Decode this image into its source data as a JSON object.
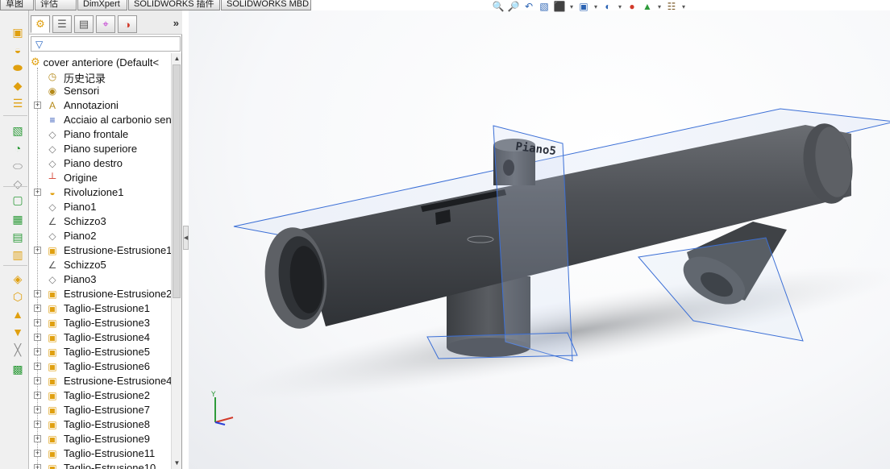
{
  "tabs": [
    "草图",
    "评估",
    "DimXpert",
    "SOLIDWORKS 插件",
    "SOLIDWORKS MBD"
  ],
  "hud_icons": [
    "zoom-to-fit-icon",
    "zoom-area-icon",
    "previous-view-icon",
    "section-view-icon",
    "view-orientation-icon",
    "display-style-icon",
    "hide-show-icon",
    "edit-appearance-icon",
    "apply-scene-icon",
    "view-settings-icon"
  ],
  "feature_manager": {
    "root": "cover anteriore  (Default<",
    "items": [
      {
        "label": "历史记录",
        "icon": "history-icon",
        "expand": false
      },
      {
        "label": "Sensori",
        "icon": "sensor-icon",
        "expand": false
      },
      {
        "label": "Annotazioni",
        "icon": "annotation-icon",
        "expand": true
      },
      {
        "label": "Acciaio al carbonio sen",
        "icon": "material-icon",
        "expand": false
      },
      {
        "label": "Piano frontale",
        "icon": "plane-icon",
        "expand": false
      },
      {
        "label": "Piano superiore",
        "icon": "plane-icon",
        "expand": false
      },
      {
        "label": "Piano destro",
        "icon": "plane-icon",
        "expand": false
      },
      {
        "label": "Origine",
        "icon": "origin-icon",
        "expand": false
      },
      {
        "label": "Rivoluzione1",
        "icon": "revolve-icon",
        "expand": true
      },
      {
        "label": "Piano1",
        "icon": "plane-icon",
        "expand": false
      },
      {
        "label": "Schizzo3",
        "icon": "sketch-icon",
        "expand": false
      },
      {
        "label": "Piano2",
        "icon": "plane-icon",
        "expand": false
      },
      {
        "label": "Estrusione-Estrusione1",
        "icon": "extrude-icon",
        "expand": true
      },
      {
        "label": "Schizzo5",
        "icon": "sketch-icon",
        "expand": false
      },
      {
        "label": "Piano3",
        "icon": "plane-icon",
        "expand": false
      },
      {
        "label": "Estrusione-Estrusione2",
        "icon": "extrude-icon",
        "expand": true
      },
      {
        "label": "Taglio-Estrusione1",
        "icon": "cut-extrude-icon",
        "expand": true
      },
      {
        "label": "Taglio-Estrusione3",
        "icon": "cut-extrude-icon",
        "expand": true
      },
      {
        "label": "Taglio-Estrusione4",
        "icon": "cut-extrude-icon",
        "expand": true
      },
      {
        "label": "Taglio-Estrusione5",
        "icon": "cut-extrude-icon",
        "expand": true
      },
      {
        "label": "Taglio-Estrusione6",
        "icon": "cut-extrude-icon",
        "expand": true
      },
      {
        "label": "Estrusione-Estrusione4",
        "icon": "extrude-icon",
        "expand": true
      },
      {
        "label": "Taglio-Estrusione2",
        "icon": "cut-extrude-icon",
        "expand": true
      },
      {
        "label": "Taglio-Estrusione7",
        "icon": "cut-extrude-icon",
        "expand": true
      },
      {
        "label": "Taglio-Estrusione8",
        "icon": "cut-extrude-icon",
        "expand": true
      },
      {
        "label": "Taglio-Estrusione9",
        "icon": "cut-extrude-icon",
        "expand": true
      },
      {
        "label": "Taglio-Estrusione11",
        "icon": "cut-extrude-icon",
        "expand": true
      },
      {
        "label": "Taglio-Estrusione10",
        "icon": "cut-extrude-icon",
        "expand": true
      }
    ]
  },
  "viewport": {
    "plane_label": "Piano5",
    "triad": {
      "y": "Y"
    }
  },
  "colors": {
    "part": "#4a4d52",
    "plane": "#3b6fd6",
    "accent": "#1f5fbf"
  }
}
